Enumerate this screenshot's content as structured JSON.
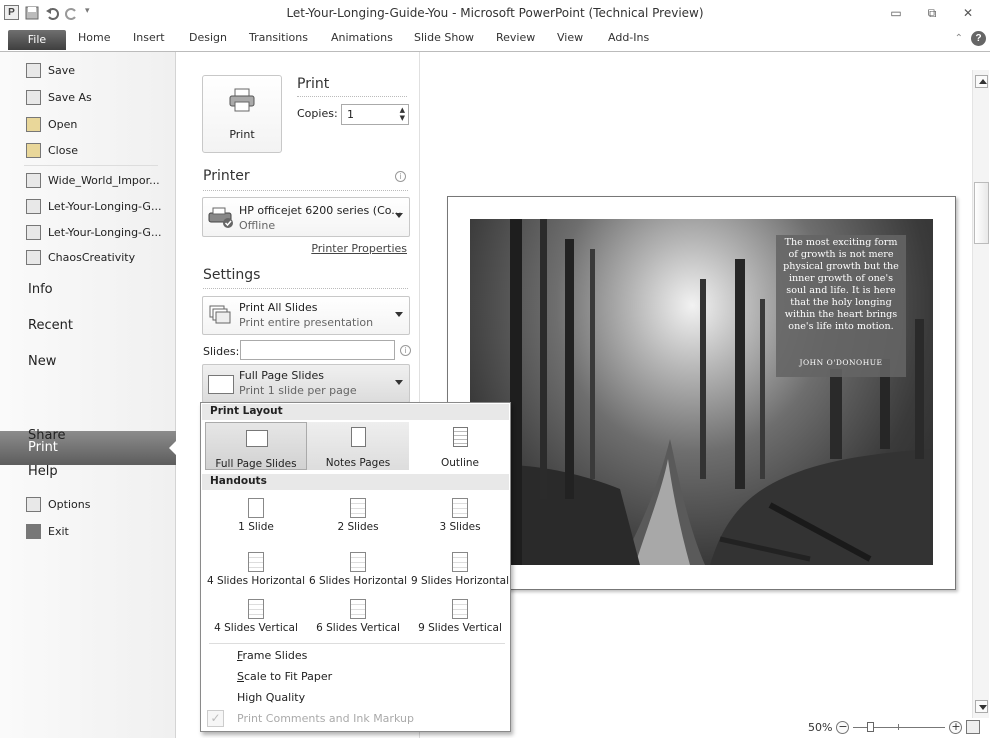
{
  "window": {
    "title": "Let-Your-Longing-Guide-You - Microsoft PowerPoint (Technical Preview)",
    "app_icon_letter": "P"
  },
  "ribbon": {
    "tabs": [
      "File",
      "Home",
      "Insert",
      "Design",
      "Transitions",
      "Animations",
      "Slide Show",
      "Review",
      "View",
      "Add-Ins"
    ]
  },
  "nav": {
    "commands": [
      "Save",
      "Save As",
      "Open",
      "Close"
    ],
    "recent_files": [
      "Wide_World_Impor...",
      "Let-Your-Longing-G...",
      "Let-Your-Longing-G...",
      "ChaosCreativity"
    ],
    "items": [
      "Info",
      "Recent",
      "New",
      "Print",
      "Share",
      "Help"
    ],
    "bottom_commands": [
      "Options",
      "Exit"
    ]
  },
  "print": {
    "button_label": "Print",
    "heading": "Print",
    "copies_label": "Copies:",
    "copies_value": "1",
    "printer_heading": "Printer",
    "printer_name": "HP officejet 6200 series (Co...",
    "printer_status": "Offline",
    "printer_properties": "Printer Properties",
    "settings_heading": "Settings",
    "range_main": "Print All Slides",
    "range_sub": "Print entire presentation",
    "slides_label": "Slides:",
    "slides_value": "",
    "layout_main": "Full Page Slides",
    "layout_sub": "Print 1 slide per page"
  },
  "popup": {
    "print_layout_heading": "Print Layout",
    "layouts": [
      "Full Page Slides",
      "Notes Pages",
      "Outline"
    ],
    "handouts_heading": "Handouts",
    "handouts": [
      "1 Slide",
      "2 Slides",
      "3 Slides",
      "4 Slides Horizontal",
      "6 Slides Horizontal",
      "9 Slides Horizontal",
      "4 Slides Vertical",
      "6 Slides Vertical",
      "9 Slides Vertical"
    ],
    "options": [
      {
        "prefix": "",
        "accel": "F",
        "rest": "rame Slides"
      },
      {
        "prefix": "",
        "accel": "S",
        "rest": "cale to Fit Paper"
      },
      {
        "prefix": "High Quality",
        "accel": "",
        "rest": ""
      },
      {
        "prefix": "Print Comments and Ink Markup",
        "accel": "",
        "rest": ""
      }
    ]
  },
  "slide": {
    "quote": "The most exciting form of growth is not mere physical growth but the inner growth of one's soul and life. It is here that the holy longing within the heart brings one's life into motion.",
    "author": "JOHN O'DONOHUE"
  },
  "zoom": {
    "level": "50%"
  }
}
